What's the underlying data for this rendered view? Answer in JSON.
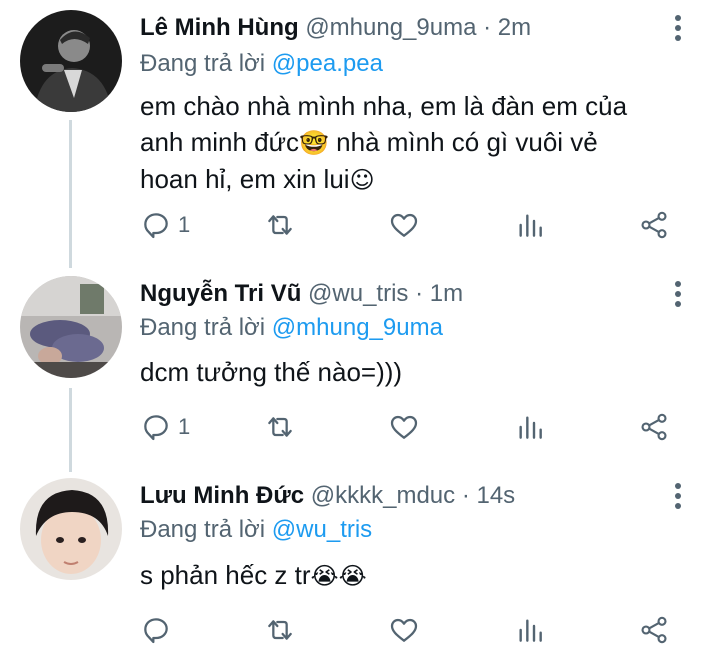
{
  "tweets": [
    {
      "name": "Lê Minh Hùng",
      "handle": "@mhung_9uma",
      "separator": " · ",
      "time": "2m",
      "replying_prefix": "Đang trả lời ",
      "replying_to": "@pea.pea",
      "text_lines": [
        "em chào nhà mình nha, em là đàn em của",
        "anh minh đức",
        " nhà mình có gì vuôi vẻ",
        "hoan hỉ, em xin lui"
      ],
      "emoji_1": "🤓",
      "emoji_2": "☺",
      "reply_count": "1"
    },
    {
      "name": "Nguyễn Tri Vũ",
      "handle": "@wu_tris",
      "separator": " · ",
      "time": "1m",
      "replying_prefix": "Đang trả lời ",
      "replying_to": "@mhung_9uma",
      "text": "dcm tưởng thế nào=)))",
      "reply_count": "1"
    },
    {
      "name": "Lưu Minh Đức",
      "handle": "@kkkk_mduc",
      "separator": " · ",
      "time": "14s",
      "replying_prefix": "Đang trả lời ",
      "replying_to": "@wu_tris",
      "text": "s phản hếc z tr",
      "emoji": "😭😭",
      "reply_count": ""
    }
  ],
  "icons": [
    "reply-icon",
    "retweet-icon",
    "like-icon",
    "analytics-icon",
    "share-icon",
    "more-icon"
  ],
  "colors": {
    "link": "#1d9bf0",
    "secondary": "#536471",
    "thread": "#cfd9de"
  }
}
